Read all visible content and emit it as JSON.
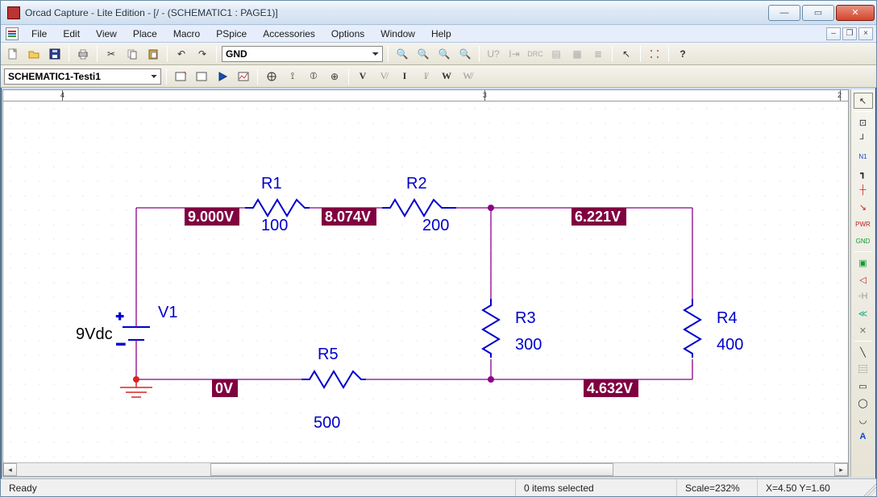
{
  "window": {
    "title": "Orcad Capture - Lite Edition - [/ - (SCHEMATIC1 : PAGE1)]"
  },
  "menus": [
    "File",
    "Edit",
    "View",
    "Place",
    "Macro",
    "PSpice",
    "Accessories",
    "Options",
    "Window",
    "Help"
  ],
  "toolbar": {
    "net_combo": "GND",
    "schematic_combo": "SCHEMATIC1-Testi1"
  },
  "ruler": {
    "ticks": [
      {
        "pos_pct": 7,
        "label": "4"
      },
      {
        "pos_pct": 57,
        "label": "3"
      },
      {
        "pos_pct": 99,
        "label": "2"
      }
    ]
  },
  "schematic": {
    "source": {
      "name": "V1",
      "value": "9Vdc"
    },
    "resistors": [
      {
        "name": "R1",
        "value": "100"
      },
      {
        "name": "R2",
        "value": "200"
      },
      {
        "name": "R3",
        "value": "300"
      },
      {
        "name": "R4",
        "value": "400"
      },
      {
        "name": "R5",
        "value": "500"
      }
    ],
    "probes": [
      {
        "label": "9.000V"
      },
      {
        "label": "8.074V"
      },
      {
        "label": "6.221V"
      },
      {
        "label": "0V"
      },
      {
        "label": "4.632V"
      }
    ]
  },
  "statusbar": {
    "ready": "Ready",
    "selection": "0 items selected",
    "scale": "Scale=232%",
    "coords": "X=4.50  Y=1.60"
  }
}
